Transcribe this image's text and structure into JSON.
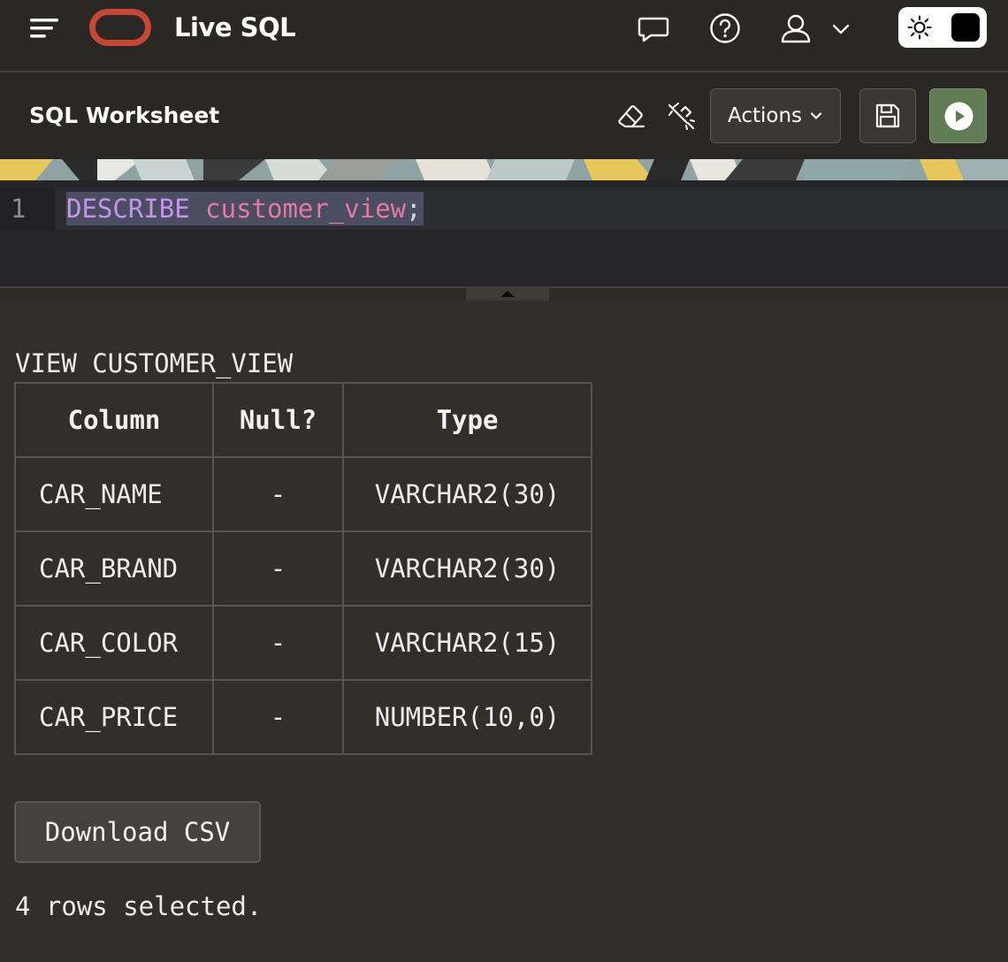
{
  "app": {
    "title": "Live SQL"
  },
  "topbar": {
    "icons": [
      "menu-icon",
      "oracle-logo",
      "feedback-icon",
      "help-icon",
      "user-icon",
      "chevron-down-icon",
      "sun-icon"
    ],
    "brand_color": "#c74634"
  },
  "worksheet": {
    "title": "SQL Worksheet",
    "actions_label": "Actions",
    "run_color": "#5f7c55"
  },
  "editor": {
    "line_number": "1",
    "keyword": "DESCRIBE",
    "identifier": "customer_view",
    "terminator": ";"
  },
  "result": {
    "title": "VIEW CUSTOMER_VIEW",
    "headers": [
      "Column",
      "Null?",
      "Type"
    ],
    "rows": [
      [
        "CAR_NAME",
        "-",
        "VARCHAR2(30)"
      ],
      [
        "CAR_BRAND",
        "-",
        "VARCHAR2(30)"
      ],
      [
        "CAR_COLOR",
        "-",
        "VARCHAR2(15)"
      ],
      [
        "CAR_PRICE",
        "-",
        "NUMBER(10,0)"
      ]
    ],
    "download_label": "Download CSV",
    "summary": "4 rows selected."
  }
}
